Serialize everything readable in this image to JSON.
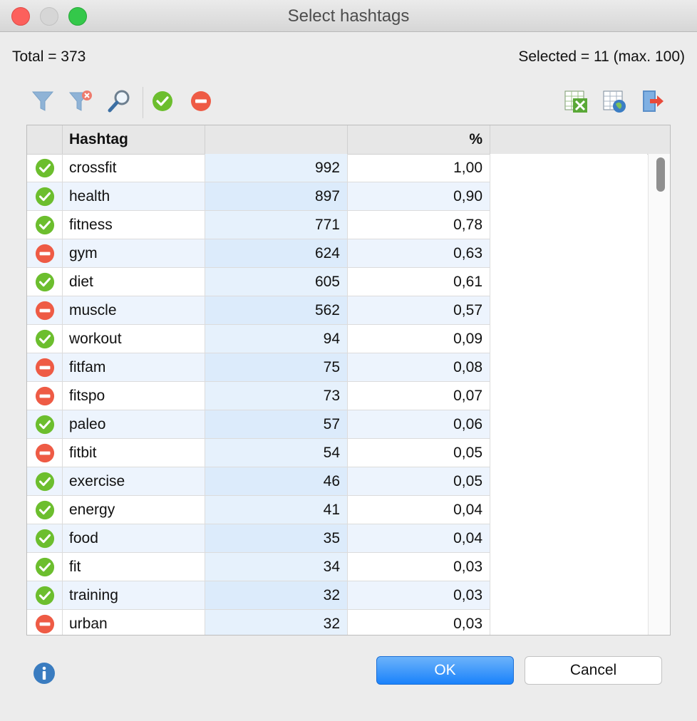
{
  "window": {
    "title": "Select hashtags"
  },
  "summary": {
    "total": "Total = 373",
    "selected": "Selected = 11 (max. 100)"
  },
  "toolbar": {
    "icons": [
      "filter-icon",
      "clear-filter-icon",
      "search-icon",
      "select-all-icon",
      "deselect-all-icon",
      "export-excel-icon",
      "export-html-icon",
      "exit-icon"
    ]
  },
  "table": {
    "headers": {
      "status": "",
      "hashtag": "Hashtag",
      "count": "",
      "percent": "%"
    },
    "rows": [
      {
        "status": "selected",
        "hashtag": "crossfit",
        "count": "992",
        "percent": "1,00"
      },
      {
        "status": "selected",
        "hashtag": "health",
        "count": "897",
        "percent": "0,90"
      },
      {
        "status": "selected",
        "hashtag": "fitness",
        "count": "771",
        "percent": "0,78"
      },
      {
        "status": "excluded",
        "hashtag": "gym",
        "count": "624",
        "percent": "0,63"
      },
      {
        "status": "selected",
        "hashtag": "diet",
        "count": "605",
        "percent": "0,61"
      },
      {
        "status": "excluded",
        "hashtag": "muscle",
        "count": "562",
        "percent": "0,57"
      },
      {
        "status": "selected",
        "hashtag": "workout",
        "count": "94",
        "percent": "0,09"
      },
      {
        "status": "excluded",
        "hashtag": "fitfam",
        "count": "75",
        "percent": "0,08"
      },
      {
        "status": "excluded",
        "hashtag": "fitspo",
        "count": "73",
        "percent": "0,07"
      },
      {
        "status": "selected",
        "hashtag": "paleo",
        "count": "57",
        "percent": "0,06"
      },
      {
        "status": "excluded",
        "hashtag": "fitbit",
        "count": "54",
        "percent": "0,05"
      },
      {
        "status": "selected",
        "hashtag": "exercise",
        "count": "46",
        "percent": "0,05"
      },
      {
        "status": "selected",
        "hashtag": "energy",
        "count": "41",
        "percent": "0,04"
      },
      {
        "status": "selected",
        "hashtag": "food",
        "count": "35",
        "percent": "0,04"
      },
      {
        "status": "selected",
        "hashtag": "fit",
        "count": "34",
        "percent": "0,03"
      },
      {
        "status": "selected",
        "hashtag": "training",
        "count": "32",
        "percent": "0,03"
      },
      {
        "status": "excluded",
        "hashtag": "urban",
        "count": "32",
        "percent": "0,03"
      }
    ]
  },
  "buttons": {
    "ok": "OK",
    "cancel": "Cancel"
  },
  "colors": {
    "check": "#6cbe2e",
    "minus": "#ee5b45",
    "accent": "#1a82fb"
  }
}
